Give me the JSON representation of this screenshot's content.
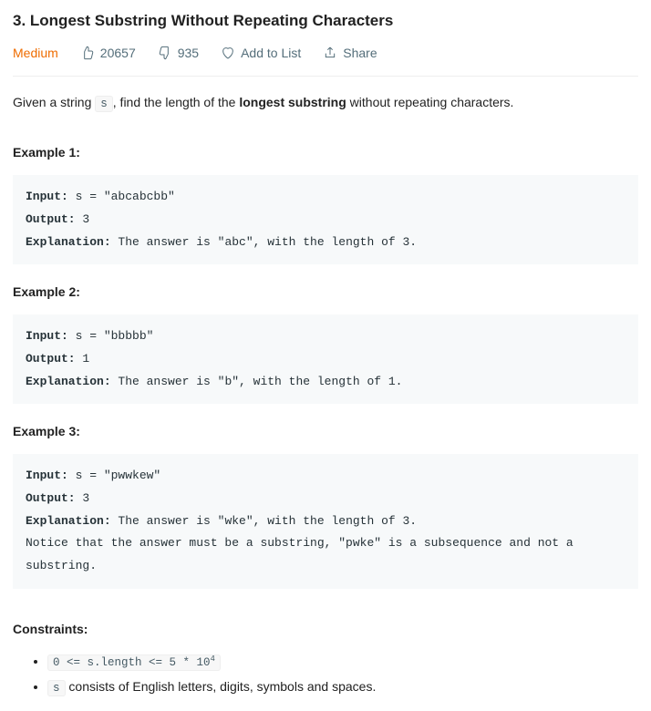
{
  "title": "3. Longest Substring Without Repeating Characters",
  "meta": {
    "difficulty": "Medium",
    "likes": "20657",
    "dislikes": "935",
    "addToList": "Add to List",
    "share": "Share"
  },
  "description": {
    "prefix": "Given a string ",
    "code": "s",
    "middle": ", find the length of the ",
    "bold": "longest substring",
    "suffix": " without repeating characters."
  },
  "examples": [
    {
      "label": "Example 1:",
      "input": "s = \"abcabcbb\"",
      "output": "3",
      "explanation": "The answer is \"abc\", with the length of 3."
    },
    {
      "label": "Example 2:",
      "input": "s = \"bbbbb\"",
      "output": "1",
      "explanation": "The answer is \"b\", with the length of 1."
    },
    {
      "label": "Example 3:",
      "input": "s = \"pwwkew\"",
      "output": "3",
      "explanation": "The answer is \"wke\", with the length of 3.\nNotice that the answer must be a substring, \"pwke\" is a subsequence and not a substring."
    }
  ],
  "labels": {
    "input": "Input:",
    "output": "Output:",
    "explanation": "Explanation:"
  },
  "constraintsLabel": "Constraints:",
  "constraints": {
    "c1": "0 <= s.length <= 5 * 10",
    "c1sup": "4",
    "c2code": "s",
    "c2text": " consists of English letters, digits, symbols and spaces."
  }
}
